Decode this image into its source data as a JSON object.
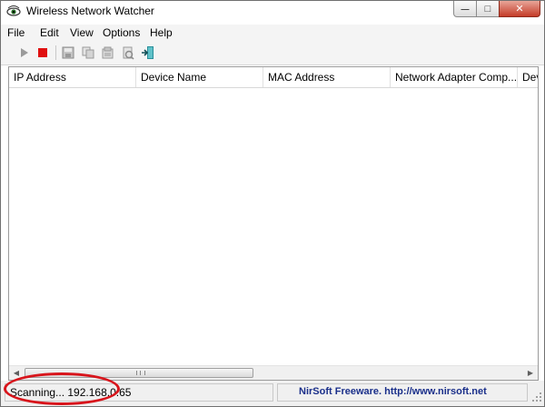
{
  "window": {
    "title": "Wireless Network Watcher",
    "min_glyph": "—",
    "max_glyph": "□",
    "close_glyph": "✕"
  },
  "menu": {
    "items": [
      "File",
      "Edit",
      "View",
      "Options",
      "Help"
    ]
  },
  "toolbar": {
    "icons": [
      "play-icon",
      "stop-icon",
      "save-icon",
      "copy-icon",
      "properties-icon",
      "refresh-icon",
      "exit-icon"
    ]
  },
  "list": {
    "columns": [
      "IP Address",
      "Device Name",
      "MAC Address",
      "Network Adapter Comp...",
      "Dev"
    ],
    "rows": []
  },
  "status": {
    "scan_text": "Scanning... 192.168.0.65",
    "freeware_text": "NirSoft Freeware.  http://www.nirsoft.net"
  },
  "colors": {
    "stop_red": "#e01010",
    "link_blue": "#1a2f8a",
    "annotation_red": "#d8141b"
  }
}
